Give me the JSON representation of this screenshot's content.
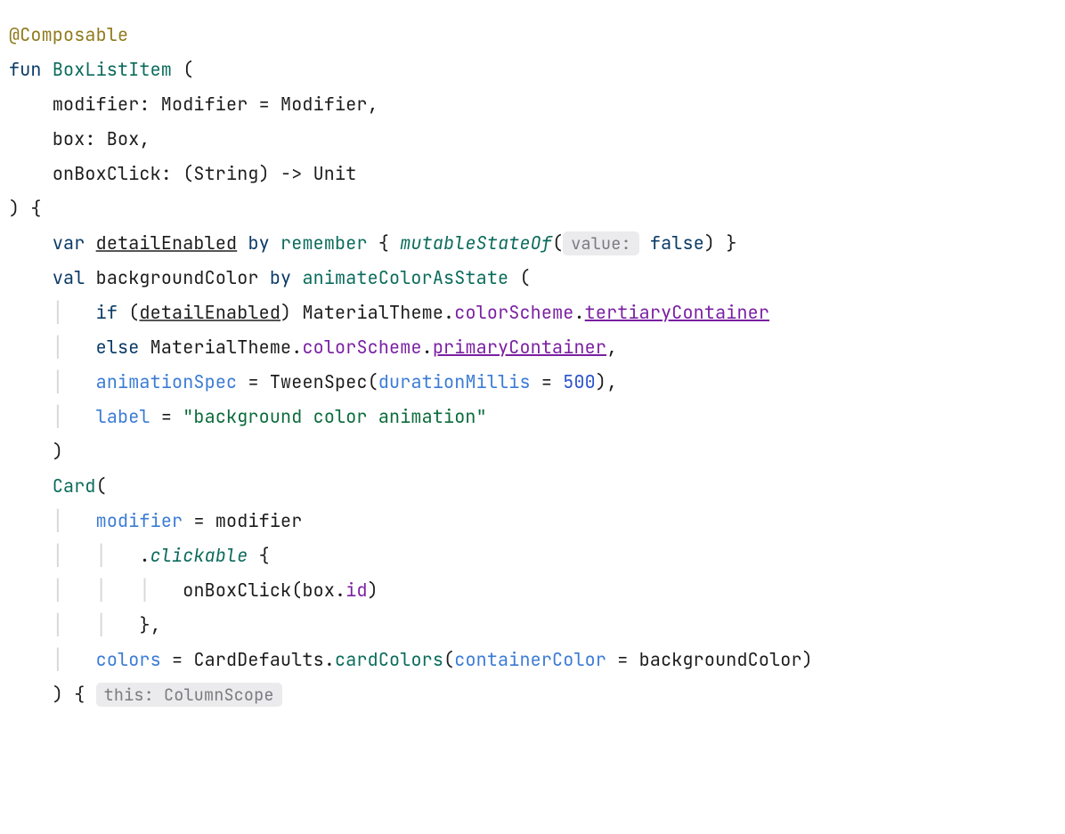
{
  "code": {
    "guide": "│",
    "dot": ".",
    "comma": ",",
    "eq": "=",
    "popen": "(",
    "pclose": ")",
    "bopen": "{",
    "l1": {
      "annotation": "@Composable"
    },
    "l2": {
      "kw": "fun",
      "fn": "BoxListItem",
      "open": "("
    },
    "l3": "modifier: Modifier = Modifier,",
    "l4": "box: Box,",
    "l5": "onBoxClick: (String) -> Unit",
    "l6": ") {",
    "l7": {
      "kw": "var",
      "var": "detailEnabled",
      "by": "by",
      "remember": "remember",
      "brace": "{",
      "msof": "mutableStateOf",
      "popen": "(",
      "hint": "value:",
      "false": "false",
      "pclose": ")",
      "bclose": "}"
    },
    "l8": {
      "kw": "val",
      "var": "backgroundColor",
      "by": "by",
      "fn": "animateColorAsState",
      "open": "("
    },
    "l9": {
      "kw": "if",
      "open": "(",
      "de": "detailEnabled",
      "close": ")",
      "mt": "MaterialTheme.",
      "cs": "colorScheme",
      "tc": "tertiaryContainer"
    },
    "l10": {
      "kw": "else",
      "mt": "MaterialTheme.",
      "cs": "colorScheme",
      "pc": "primaryContainer"
    },
    "l11": {
      "param": "animationSpec",
      "tw": "TweenSpec",
      "dm": "durationMillis",
      "num": "500",
      "close": "),"
    },
    "l12": {
      "param": "label",
      "str": "\"background color animation\""
    },
    "l13": ")",
    "l14": {
      "fn": "Card"
    },
    "l15": {
      "param": "modifier",
      "mod": "modifier"
    },
    "l16": {
      "click": "clickable"
    },
    "l17": {
      "call": "onBoxClick",
      "box": "box.",
      "id": "id"
    },
    "l18": "},",
    "l19": {
      "param": "colors",
      "cd": "CardDefaults",
      "cc": "cardColors",
      "ccparam": "containerColor",
      "bg": "backgroundColor"
    },
    "l20": {
      "pb": ") {",
      "hint": "this: ColumnScope"
    }
  }
}
